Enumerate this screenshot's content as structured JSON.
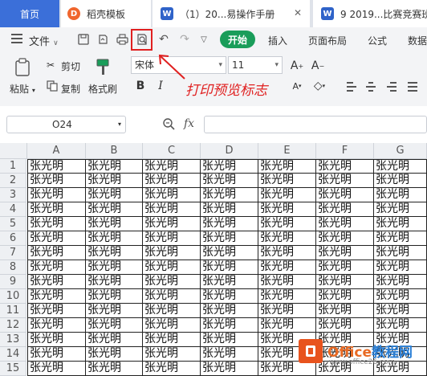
{
  "tabs": [
    {
      "label": "首页",
      "icon": "none"
    },
    {
      "label": "稻壳模板",
      "icon": "daoke-logo-icon"
    },
    {
      "label": "（1）20...易操作手册",
      "icon": "word-doc-icon"
    },
    {
      "label": "9 2019...比赛竞赛班",
      "icon": "word-doc-icon"
    }
  ],
  "toolbar": {
    "file_label": "文件",
    "start_label": "开始",
    "menu": [
      "插入",
      "页面布局",
      "公式",
      "数据"
    ]
  },
  "ribbon": {
    "paste_label": "粘贴",
    "cut_label": "剪切",
    "copy_label": "复制",
    "format_painter_label": "格式刷",
    "font_name": "宋体",
    "font_size": "11",
    "bold": "B",
    "italic": "I"
  },
  "annotation": "打印预览标志",
  "formula_bar": {
    "cell_ref": "O24",
    "fx": "fx",
    "value": ""
  },
  "sheet": {
    "columns": [
      "A",
      "B",
      "C",
      "D",
      "E",
      "F",
      "G"
    ],
    "rows": [
      "1",
      "2",
      "3",
      "4",
      "5",
      "6",
      "7",
      "8",
      "9",
      "10",
      "11",
      "12",
      "13",
      "14",
      "15"
    ],
    "cell_text": "张光明"
  },
  "watermark": {
    "brand": "Office",
    "brand_cn": "教程网",
    "url": "www.office26.com"
  },
  "colors": {
    "tab_active": "#3b6fd9",
    "start_button": "#1a9d5a",
    "annotation": "#e02020"
  }
}
